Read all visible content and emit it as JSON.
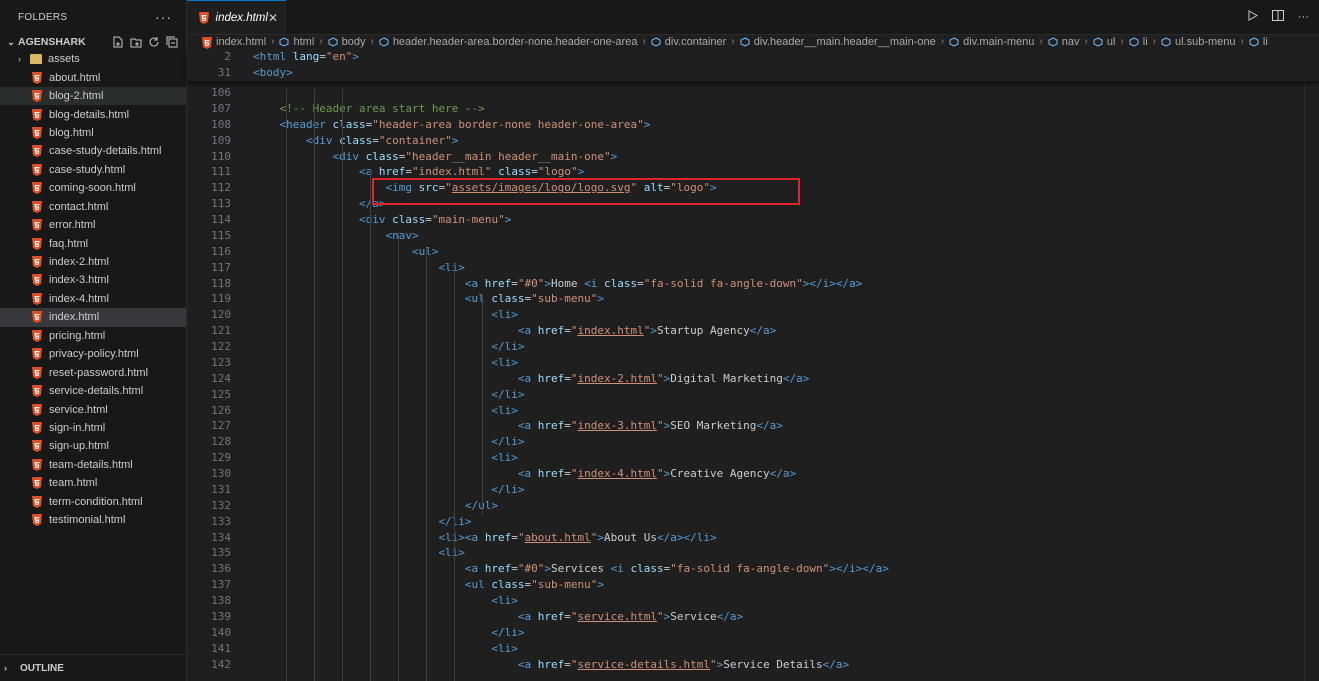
{
  "sidebar": {
    "title": "FOLDERS",
    "root": "AGENSHARK",
    "folder": "assets",
    "files": [
      "about.html",
      "blog-2.html",
      "blog-details.html",
      "blog.html",
      "case-study-details.html",
      "case-study.html",
      "coming-soon.html",
      "contact.html",
      "error.html",
      "faq.html",
      "index-2.html",
      "index-3.html",
      "index-4.html",
      "index.html",
      "pricing.html",
      "privacy-policy.html",
      "reset-password.html",
      "service-details.html",
      "service.html",
      "sign-in.html",
      "sign-up.html",
      "team-details.html",
      "team.html",
      "term-condition.html",
      "testimonial.html"
    ],
    "outline": "OUTLINE"
  },
  "tab": {
    "label": "index.html",
    "close": "✕"
  },
  "breadcrumb": [
    "index.html",
    "html",
    "body",
    "header.header-area.border-none.header-one-area",
    "div.container",
    "div.header__main.header__main-one",
    "div.main-menu",
    "nav",
    "ul",
    "li",
    "ul.sub-menu",
    "li"
  ],
  "sticky": [
    {
      "n": "2",
      "html": "<span class=\"tg\">&lt;html</span> <span class=\"at\">lang</span><span class=\"tx\">=</span><span class=\"st\">\"en\"</span><span class=\"tg\">&gt;</span>"
    },
    {
      "n": "31",
      "html": "<span class=\"tg\">&lt;body&gt;</span>"
    }
  ],
  "lines": [
    {
      "n": "106",
      "html": ""
    },
    {
      "n": "107",
      "html": "    <span class=\"cm\">&lt;!-- Header area start here --&gt;</span>"
    },
    {
      "n": "108",
      "html": "    <span class=\"tg\">&lt;header</span> <span class=\"at\">class</span>=<span class=\"st\">\"header-area border-none header-one-area\"</span><span class=\"tg\">&gt;</span>"
    },
    {
      "n": "109",
      "html": "        <span class=\"tg\">&lt;div</span> <span class=\"at\">class</span>=<span class=\"st\">\"container\"</span><span class=\"tg\">&gt;</span>"
    },
    {
      "n": "110",
      "html": "            <span class=\"tg\">&lt;div</span> <span class=\"at\">class</span>=<span class=\"st\">\"header__main header__main-one\"</span><span class=\"tg\">&gt;</span>"
    },
    {
      "n": "111",
      "html": "                <span class=\"tg\">&lt;a</span> <span class=\"at\">href</span>=<span class=\"st\">\"index.html\"</span> <span class=\"at\">class</span>=<span class=\"st\">\"logo\"</span><span class=\"tg\">&gt;</span>"
    },
    {
      "n": "112",
      "html": "                    <span class=\"tg\">&lt;img</span> <span class=\"at\">src</span>=<span class=\"st\">\"<span class=\"ul\">assets/images/logo/logo.svg</span>\"</span> <span class=\"at\">alt</span>=<span class=\"st\">\"logo\"</span><span class=\"tg\">&gt;</span>"
    },
    {
      "n": "113",
      "html": "                <span class=\"tg\">&lt;/a&gt;</span>"
    },
    {
      "n": "114",
      "html": "                <span class=\"tg\">&lt;div</span> <span class=\"at\">class</span>=<span class=\"st\">\"main-menu\"</span><span class=\"tg\">&gt;</span>"
    },
    {
      "n": "115",
      "html": "                    <span class=\"tg\">&lt;nav&gt;</span>"
    },
    {
      "n": "116",
      "html": "                        <span class=\"tg\">&lt;ul&gt;</span>"
    },
    {
      "n": "117",
      "html": "                            <span class=\"tg\">&lt;li&gt;</span>"
    },
    {
      "n": "118",
      "html": "                                <span class=\"tg\">&lt;a</span> <span class=\"at\">href</span>=<span class=\"st\">\"#0\"</span><span class=\"tg\">&gt;</span>Home <span class=\"tg\">&lt;i</span> <span class=\"at\">class</span>=<span class=\"st\">\"fa-solid fa-angle-down\"</span><span class=\"tg\">&gt;&lt;/i&gt;&lt;/a&gt;</span>"
    },
    {
      "n": "119",
      "html": "                                <span class=\"tg\">&lt;ul</span> <span class=\"at\">class</span>=<span class=\"st\">\"sub-menu\"</span><span class=\"tg\">&gt;</span>"
    },
    {
      "n": "120",
      "html": "                                    <span class=\"tg\">&lt;li&gt;</span>"
    },
    {
      "n": "121",
      "html": "                                        <span class=\"tg\">&lt;a</span> <span class=\"at\">href</span>=<span class=\"st\">\"<span class=\"ul\">index.html</span>\"</span><span class=\"tg\">&gt;</span>Startup Agency<span class=\"tg\">&lt;/a&gt;</span>"
    },
    {
      "n": "122",
      "html": "                                    <span class=\"tg\">&lt;/li&gt;</span>"
    },
    {
      "n": "123",
      "html": "                                    <span class=\"tg\">&lt;li&gt;</span>"
    },
    {
      "n": "124",
      "html": "                                        <span class=\"tg\">&lt;a</span> <span class=\"at\">href</span>=<span class=\"st\">\"<span class=\"ul\">index-2.html</span>\"</span><span class=\"tg\">&gt;</span>Digital Marketing<span class=\"tg\">&lt;/a&gt;</span>"
    },
    {
      "n": "125",
      "html": "                                    <span class=\"tg\">&lt;/li&gt;</span>"
    },
    {
      "n": "126",
      "html": "                                    <span class=\"tg\">&lt;li&gt;</span>"
    },
    {
      "n": "127",
      "html": "                                        <span class=\"tg\">&lt;a</span> <span class=\"at\">href</span>=<span class=\"st\">\"<span class=\"ul\">index-3.html</span>\"</span><span class=\"tg\">&gt;</span>SEO Marketing<span class=\"tg\">&lt;/a&gt;</span>"
    },
    {
      "n": "128",
      "html": "                                    <span class=\"tg\">&lt;/li&gt;</span>"
    },
    {
      "n": "129",
      "html": "                                    <span class=\"tg\">&lt;li&gt;</span>"
    },
    {
      "n": "130",
      "html": "                                        <span class=\"tg\">&lt;a</span> <span class=\"at\">href</span>=<span class=\"st\">\"<span class=\"ul\">index-4.html</span>\"</span><span class=\"tg\">&gt;</span>Creative Agency<span class=\"tg\">&lt;/a&gt;</span>"
    },
    {
      "n": "131",
      "html": "                                    <span class=\"tg\">&lt;/li&gt;</span>"
    },
    {
      "n": "132",
      "html": "                                <span class=\"tg\">&lt;/ul&gt;</span>"
    },
    {
      "n": "133",
      "html": "                            <span class=\"tg\">&lt;/li&gt;</span>"
    },
    {
      "n": "134",
      "html": "                            <span class=\"tg\">&lt;li&gt;&lt;a</span> <span class=\"at\">href</span>=<span class=\"st\">\"<span class=\"ul\">about.html</span>\"</span><span class=\"tg\">&gt;</span>About Us<span class=\"tg\">&lt;/a&gt;&lt;/li&gt;</span>"
    },
    {
      "n": "135",
      "html": "                            <span class=\"tg\">&lt;li&gt;</span>"
    },
    {
      "n": "136",
      "html": "                                <span class=\"tg\">&lt;a</span> <span class=\"at\">href</span>=<span class=\"st\">\"#0\"</span><span class=\"tg\">&gt;</span>Services <span class=\"tg\">&lt;i</span> <span class=\"at\">class</span>=<span class=\"st\">\"fa-solid fa-angle-down\"</span><span class=\"tg\">&gt;&lt;/i&gt;&lt;/a&gt;</span>"
    },
    {
      "n": "137",
      "html": "                                <span class=\"tg\">&lt;ul</span> <span class=\"at\">class</span>=<span class=\"st\">\"sub-menu\"</span><span class=\"tg\">&gt;</span>"
    },
    {
      "n": "138",
      "html": "                                    <span class=\"tg\">&lt;li&gt;</span>"
    },
    {
      "n": "139",
      "html": "                                        <span class=\"tg\">&lt;a</span> <span class=\"at\">href</span>=<span class=\"st\">\"<span class=\"ul\">service.html</span>\"</span><span class=\"tg\">&gt;</span>Service<span class=\"tg\">&lt;/a&gt;</span>"
    },
    {
      "n": "140",
      "html": "                                    <span class=\"tg\">&lt;/li&gt;</span>"
    },
    {
      "n": "141",
      "html": "                                    <span class=\"tg\">&lt;li&gt;</span>"
    },
    {
      "n": "142",
      "html": "                                        <span class=\"tg\">&lt;a</span> <span class=\"at\">href</span>=<span class=\"st\">\"<span class=\"ul\">service-details.html</span>\"</span><span class=\"tg\">&gt;</span>Service Details<span class=\"tg\">&lt;/a&gt;</span>"
    }
  ]
}
